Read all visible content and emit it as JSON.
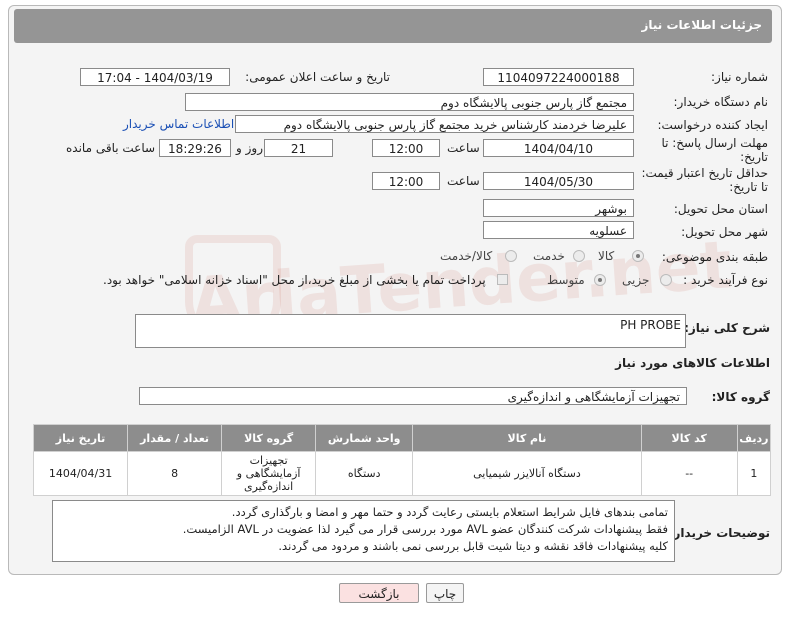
{
  "header": {
    "title": "جزئیات اطلاعات نیاز"
  },
  "fields": {
    "need_number_label": "شماره نیاز:",
    "need_number": "1104097224000188",
    "announce_label": "تاریخ و ساعت اعلان عمومی:",
    "announce_value": "1404/03/19 - 17:04",
    "buyer_org_label": "نام دستگاه خریدار:",
    "buyer_org": "مجتمع گاز پارس جنوبی  پالایشگاه دوم",
    "creator_label": "ایجاد کننده درخواست:",
    "creator": "علیرضا خردمند کارشناس خرید مجتمع گاز پارس جنوبی  پالایشگاه دوم",
    "buyer_contact_link": "اطلاعات تماس خریدار",
    "reply_deadline_label": "مهلت ارسال پاسخ: تا تاریخ:",
    "reply_date": "1404/04/10",
    "time_label": "ساعت",
    "reply_time": "12:00",
    "days_value": "21",
    "days_label": "روز و",
    "remaining_time": "18:29:26",
    "remaining_label": "ساعت باقی مانده",
    "price_deadline_label": "حداقل تاریخ اعتبار قیمت: تا تاریخ:",
    "price_date": "1404/05/30",
    "price_time": "12:00",
    "province_label": "استان محل تحویل:",
    "province": "بوشهر",
    "city_label": "شهر محل تحویل:",
    "city": "عسلویه",
    "category_label": "طبقه بندی موضوعی:",
    "category_options": [
      "کالا",
      "خدمت",
      "کالا/خدمت"
    ],
    "process_label": "نوع فرآیند خرید :",
    "process_options": [
      "جزیی",
      "متوسط"
    ],
    "payment_note": "پرداخت تمام یا بخشی از مبلغ خرید،از محل \"اسناد خزانه اسلامی\" خواهد بود."
  },
  "description": {
    "label": "شرح کلی نیاز:",
    "value": "PH PROBE"
  },
  "goods_section": {
    "title": "اطلاعات کالاهای مورد نیاز",
    "group_label": "گروه کالا:",
    "group_value": "تجهیزات آزمایشگاهی و اندازه‌گیری"
  },
  "table": {
    "headers": [
      "ردیف",
      "کد کالا",
      "نام کالا",
      "واحد شمارش",
      "گروه کالا",
      "تعداد / مقدار",
      "تاریخ نیاز"
    ],
    "rows": [
      [
        "1",
        "--",
        "دستگاه آنالایزر شیمیایی",
        "دستگاه",
        "تجهیزات آزمایشگاهی و اندازه‌گیری",
        "8",
        "1404/04/31"
      ]
    ]
  },
  "buyer_notes": {
    "label": "توضیحات خریدار:",
    "lines": [
      "تمامی بندهای فایل شرایط استعلام بایستی رعایت گردد و حتما مهر و امضا و بارگذاری گردد.",
      "فقط پیشنهادات شرکت کنندگان عضو AVL مورد بررسی قرار می گیرد لذا عضویت در AVL الزامیست.",
      "کلیه پیشنهادات فاقد نقشه و دیتا شیت قابل بررسی نمی باشند و مردود می گردند."
    ]
  },
  "buttons": {
    "print": "چاپ",
    "back": "بازگشت"
  },
  "watermark": "AriaTender.net"
}
